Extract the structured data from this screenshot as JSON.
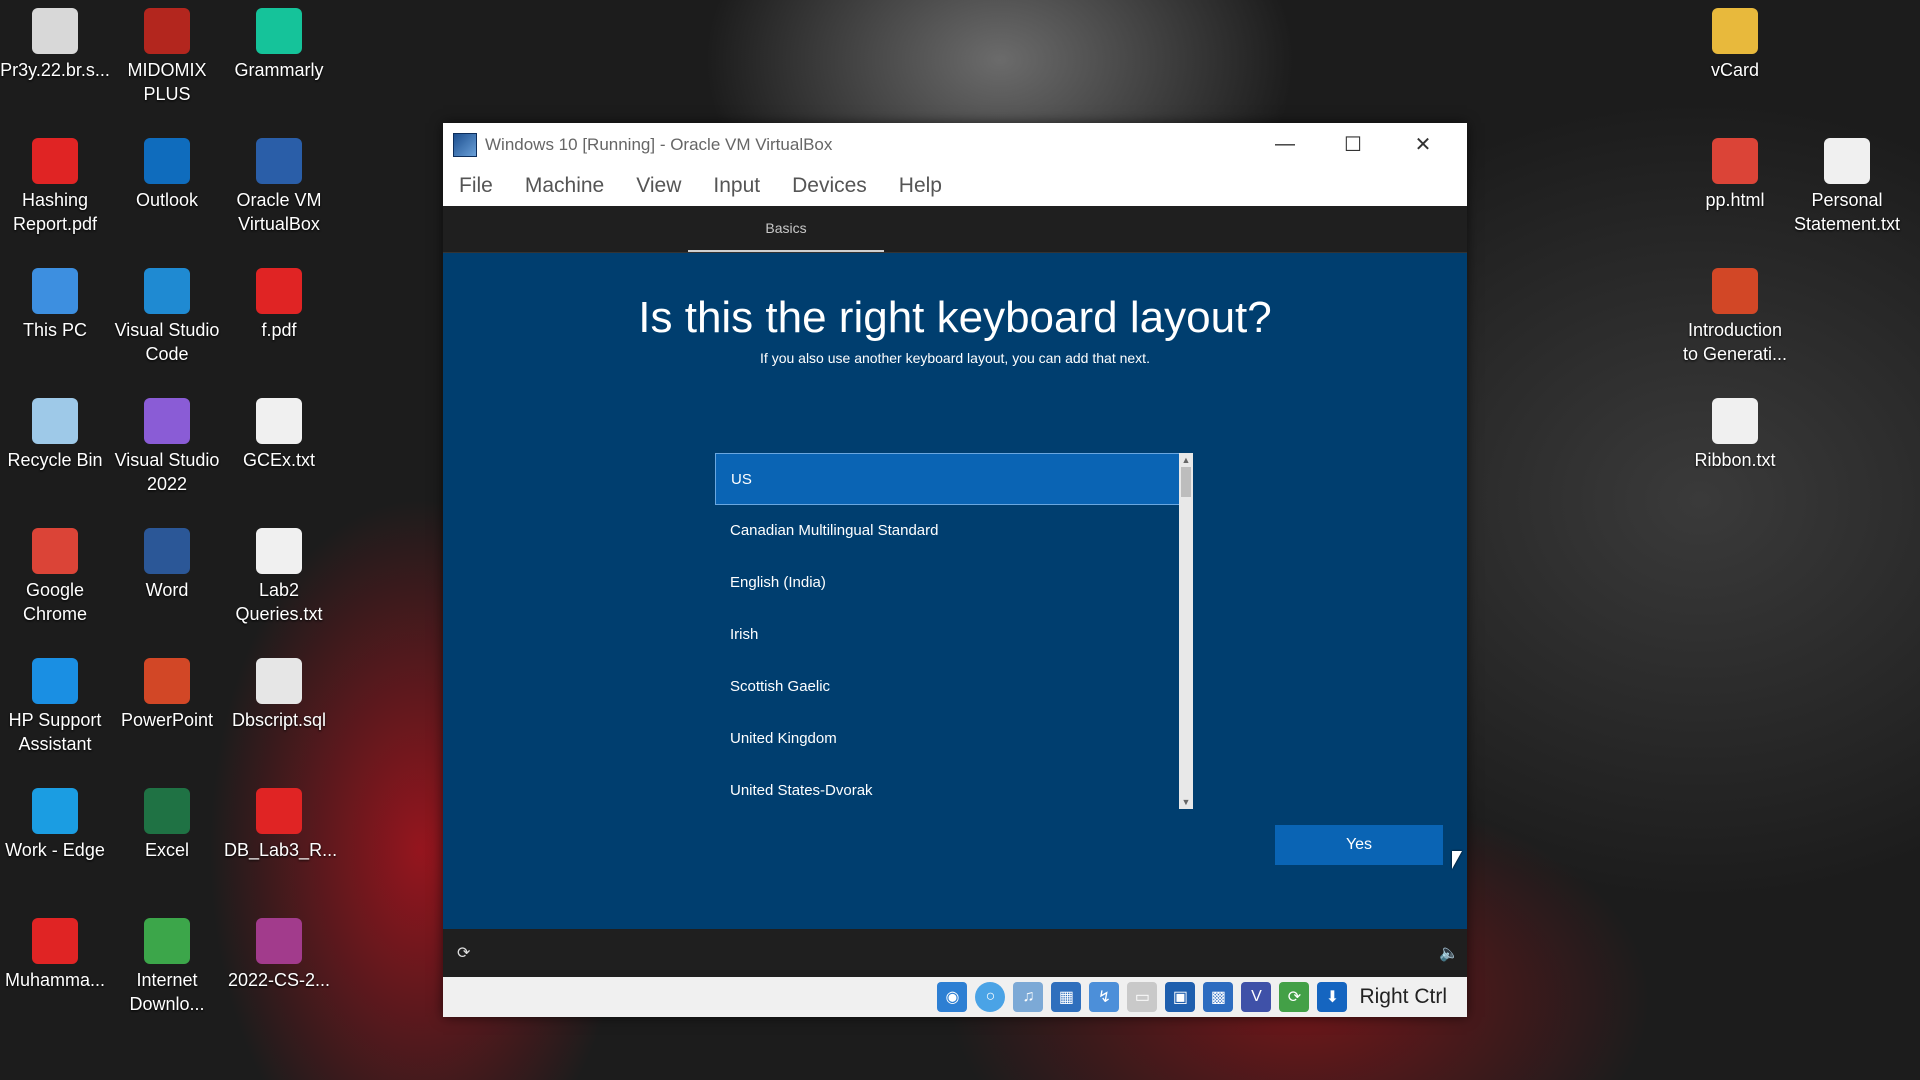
{
  "desktop": {
    "left_icons": [
      {
        "label": "Pr3y.22.br.s...",
        "icon": "file-icon",
        "color": "#d8d8d8"
      },
      {
        "label": "MIDOMIX PLUS",
        "icon": "app-icon",
        "color": "#b3261e"
      },
      {
        "label": "Grammarly",
        "icon": "grammarly-icon",
        "color": "#15c39a"
      },
      {
        "label": "Hashing Report.pdf",
        "icon": "pdf-icon",
        "color": "#e02424"
      },
      {
        "label": "Outlook",
        "icon": "outlook-icon",
        "color": "#0f6cbd"
      },
      {
        "label": "Oracle VM VirtualBox",
        "icon": "virtualbox-icon",
        "color": "#2a5ea8"
      },
      {
        "label": "This PC",
        "icon": "computer-icon",
        "color": "#3d8fe0"
      },
      {
        "label": "Visual Studio Code",
        "icon": "vscode-icon",
        "color": "#1f8ad2"
      },
      {
        "label": "f.pdf",
        "icon": "pdf-icon",
        "color": "#e02424"
      },
      {
        "label": "Recycle Bin",
        "icon": "recycle-bin-icon",
        "color": "#9ec9e8"
      },
      {
        "label": "Visual Studio 2022",
        "icon": "visual-studio-icon",
        "color": "#8a5cd6"
      },
      {
        "label": "GCEx.txt",
        "icon": "text-file-icon",
        "color": "#f0f0f0"
      },
      {
        "label": "Google Chrome",
        "icon": "chrome-icon",
        "color": "#db4437"
      },
      {
        "label": "Word",
        "icon": "word-icon",
        "color": "#2b5797"
      },
      {
        "label": "Lab2 Queries.txt",
        "icon": "text-file-icon",
        "color": "#f0f0f0"
      },
      {
        "label": "HP Support Assistant",
        "icon": "help-icon",
        "color": "#1a8fe3"
      },
      {
        "label": "PowerPoint",
        "icon": "powerpoint-icon",
        "color": "#d24726"
      },
      {
        "label": "Dbscript.sql",
        "icon": "sql-file-icon",
        "color": "#e6e6e6"
      },
      {
        "label": "Work - Edge",
        "icon": "edge-icon",
        "color": "#1b9de2"
      },
      {
        "label": "Excel",
        "icon": "excel-icon",
        "color": "#1f7244"
      },
      {
        "label": "DB_Lab3_R...",
        "icon": "pdf-icon",
        "color": "#e02424"
      },
      {
        "label": "Muhamma...",
        "icon": "pdf-icon",
        "color": "#e02424"
      },
      {
        "label": "Internet Downlo...",
        "icon": "download-manager-icon",
        "color": "#3ca64a"
      },
      {
        "label": "2022-CS-2...",
        "icon": "archive-icon",
        "color": "#a23b8c"
      }
    ],
    "right_icons": [
      {
        "label": "vCard",
        "icon": "folder-icon",
        "color": "#e8b93c"
      },
      {
        "label": "pp.html",
        "icon": "chrome-icon",
        "color": "#db4437"
      },
      {
        "label": "Personal Statement.txt",
        "icon": "text-file-icon",
        "color": "#f0f0f0"
      },
      {
        "label": "Introduction to Generati...",
        "icon": "powerpoint-icon",
        "color": "#d24726"
      },
      {
        "label": "Ribbon.txt",
        "icon": "text-file-icon",
        "color": "#f0f0f0"
      }
    ]
  },
  "window": {
    "title": "Windows 10 [Running] - Oracle VM VirtualBox",
    "menu": [
      "File",
      "Machine",
      "View",
      "Input",
      "Devices",
      "Help"
    ],
    "status_bar": {
      "icons": [
        "hard-disk-icon",
        "optical-drive-icon",
        "audio-icon",
        "network-icon",
        "usb-icon",
        "shared-folder-icon",
        "display-icon",
        "capture-icon",
        "virtualization-icon",
        "mouse-integration-icon",
        "keyboard-capture-icon"
      ],
      "host_key": "Right Ctrl"
    }
  },
  "oobe": {
    "tab": "Basics",
    "heading": "Is this the right keyboard layout?",
    "subheading": "If you also use another keyboard layout, you can add that next.",
    "layouts": [
      "US",
      "Canadian Multilingual Standard",
      "English (India)",
      "Irish",
      "Scottish Gaelic",
      "United Kingdom",
      "United States-Dvorak"
    ],
    "selected": "US",
    "yes_label": "Yes"
  }
}
